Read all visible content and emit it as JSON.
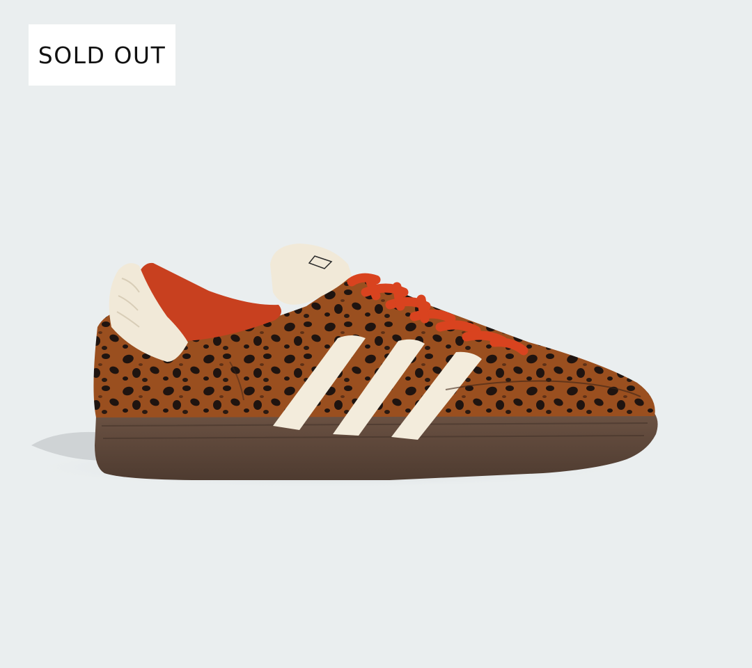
{
  "badge": {
    "label": "SOLD OUT"
  },
  "product": {
    "image_icon": "leopard-print-sneaker-icon",
    "colors": {
      "background": "#eaeeef",
      "upper_base": "#9a4f1f",
      "spots": "#1f1410",
      "stripes": "#f3ecdc",
      "laces": "#d9431f",
      "lining": "#c8401f",
      "heel_tab": "#f1e9d8",
      "sole": "#5a4538"
    }
  }
}
